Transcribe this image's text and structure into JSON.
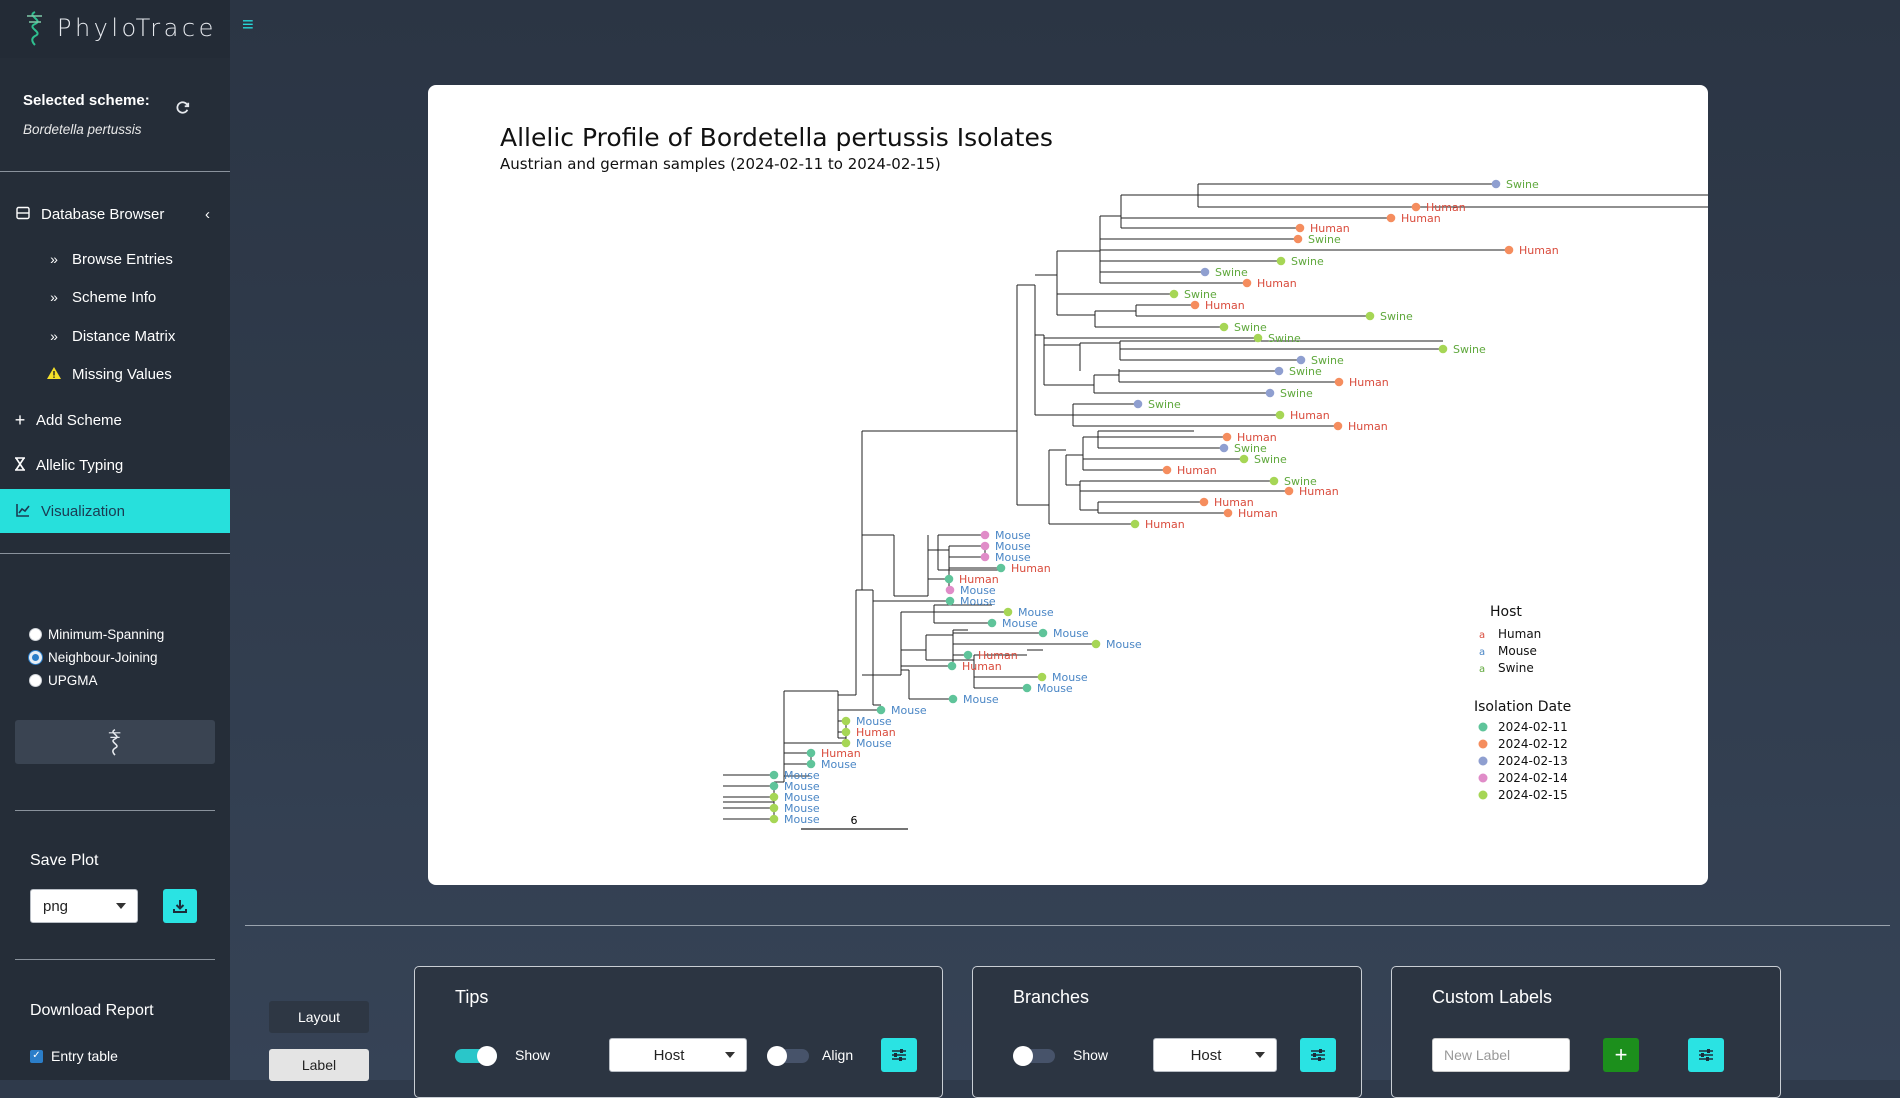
{
  "app": {
    "name": "PhyloTrace"
  },
  "sidebar": {
    "selected_scheme_label": "Selected scheme:",
    "selected_scheme_value": "Bordetella pertussis",
    "nav": {
      "database_browser": "Database Browser",
      "browse_entries": "Browse Entries",
      "scheme_info": "Scheme Info",
      "distance_matrix": "Distance Matrix",
      "missing_values": "Missing Values",
      "add_scheme": "Add Scheme",
      "allelic_typing": "Allelic Typing",
      "visualization": "Visualization"
    },
    "tree_methods": [
      "Minimum-Spanning",
      "Neighbour-Joining",
      "UPGMA"
    ],
    "selected_method": "Neighbour-Joining",
    "save_plot_title": "Save Plot",
    "save_format": "png",
    "download_report_title": "Download Report",
    "entry_table_label": "Entry table"
  },
  "plot": {
    "title": "Allelic Profile of Bordetella pertussis Isolates",
    "subtitle": "Austrian and german samples (2024-02-11 to 2024-02-15)",
    "scale_label": "6",
    "host_legend_title": "Host",
    "date_legend_title": "Isolation Date",
    "host_colors": {
      "Human": "#d94c3d",
      "Mouse": "#4a86c5",
      "Swine": "#5fa83c"
    },
    "date_colors": {
      "2024-02-11": "#5fc49a",
      "2024-02-12": "#f58d5e",
      "2024-02-13": "#8f9fd0",
      "2024-02-14": "#e08cc8",
      "2024-02-15": "#a6d655"
    },
    "hosts": [
      "Human",
      "Mouse",
      "Swine"
    ],
    "dates": [
      "2024-02-11",
      "2024-02-12",
      "2024-02-13",
      "2024-02-14",
      "2024-02-15"
    ],
    "legend_glyph": "a"
  },
  "controls": {
    "layout_tab": "Layout",
    "label_tab": "Label",
    "tips": {
      "title": "Tips",
      "show": "Show",
      "select": "Host",
      "align": "Align"
    },
    "branches": {
      "title": "Branches",
      "show": "Show",
      "select": "Host"
    },
    "custom_labels": {
      "title": "Custom Labels",
      "placeholder": "New Label"
    }
  }
}
